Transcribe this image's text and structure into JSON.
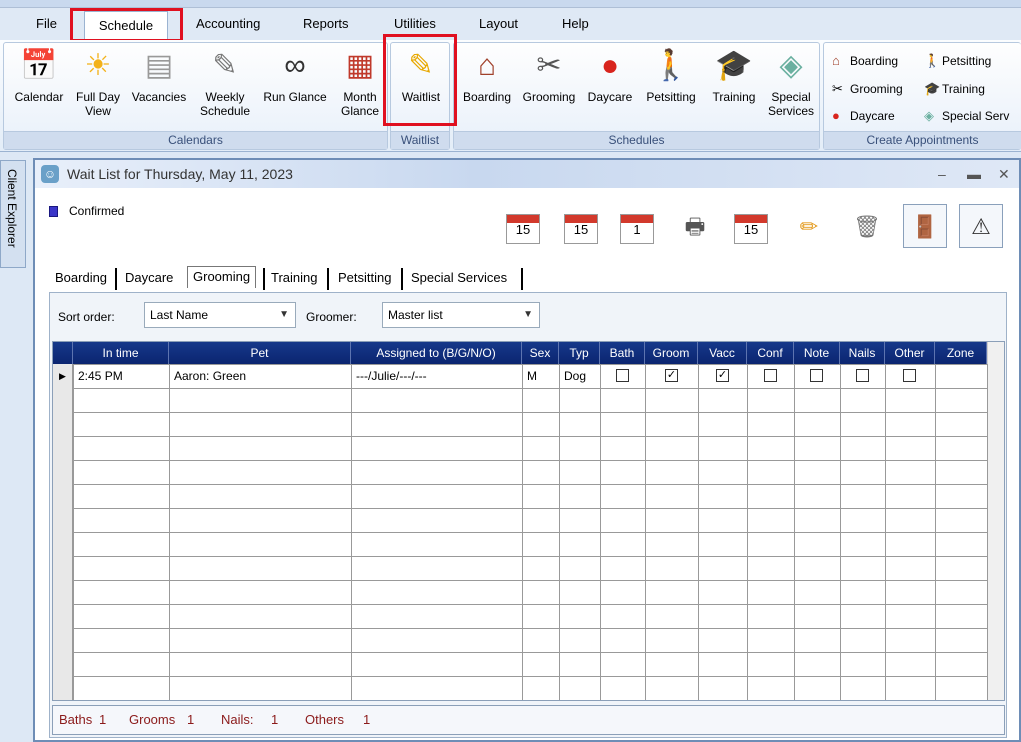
{
  "menu": {
    "file": "File",
    "schedule": "Schedule",
    "accounting": "Accounting",
    "reports": "Reports",
    "utilities": "Utilities",
    "layout": "Layout",
    "help": "Help"
  },
  "ribbon": {
    "calendars": {
      "label": "Calendars",
      "buttons": [
        "Calendar",
        "Full Day",
        "View",
        "Vacancies",
        "Weekly",
        "Schedule",
        "Run Glance",
        "Month",
        "Glance"
      ]
    },
    "waitlist": {
      "label": "Waitlist",
      "button": "Waitlist"
    },
    "schedules": {
      "label": "Schedules",
      "buttons": [
        "Boarding",
        "Grooming",
        "Daycare",
        "Petsitting",
        "Training",
        "Special",
        "Services"
      ]
    },
    "create": {
      "label": "Create Appointments",
      "buttons": [
        "Boarding",
        "Petsitting",
        "Grooming",
        "Training",
        "Daycare",
        "Special Serv"
      ]
    }
  },
  "sidetab": "Client Explorer",
  "window": {
    "title": "Wait List for Thursday, May 11, 2023",
    "legend": "Confirmed",
    "toolbar_dates": [
      "15",
      "15",
      "1",
      "15"
    ],
    "tabs": [
      "Boarding",
      "Daycare",
      "Grooming",
      "Training",
      "Petsitting",
      "Special Services"
    ],
    "active_tab": "Grooming",
    "sort_label": "Sort order:",
    "sort_value": "Last Name",
    "groomer_label": "Groomer:",
    "groomer_value": "Master list"
  },
  "grid": {
    "columns": [
      "In time",
      "Pet",
      "Assigned to (B/G/N/O)",
      "Sex",
      "Typ",
      "Bath",
      "Groom",
      "Vacc",
      "Conf",
      "Note",
      "Nails",
      "Other",
      "Zone"
    ],
    "rows": [
      {
        "in_time": "2:45 PM",
        "pet": "Aaron: Green",
        "assigned": "---/Julie/---/---",
        "sex": "M",
        "typ": "Dog",
        "bath": false,
        "groom": true,
        "vacc": true,
        "conf": false,
        "note": false,
        "nails": false,
        "other": false,
        "zone": ""
      }
    ]
  },
  "summary": {
    "baths_label": "Baths",
    "baths": "1",
    "grooms_label": "Grooms",
    "grooms": "1",
    "nails_label": "Nails:",
    "nails": "1",
    "others_label": "Others",
    "others": "1"
  },
  "colors": {
    "highlight": "#e01020",
    "header": "#0b2570",
    "summary_text": "#8b1a1a"
  }
}
